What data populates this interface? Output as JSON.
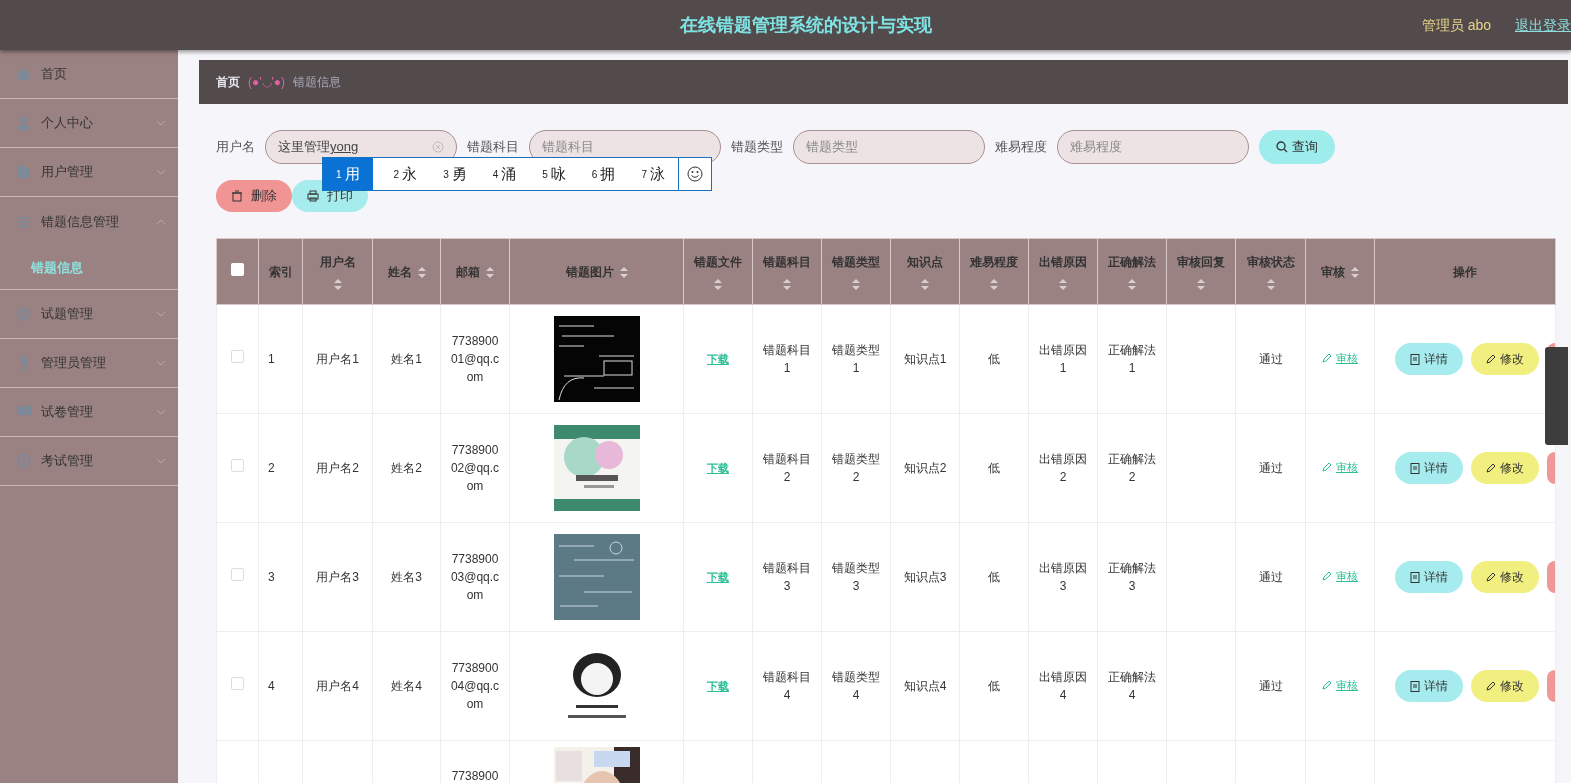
{
  "header": {
    "title": "在线错题管理系统的设计与实现",
    "user": "管理员 abo",
    "logout": "退出登录"
  },
  "sidebar": {
    "items": [
      {
        "label": "首页"
      },
      {
        "label": "个人中心",
        "expanded": false
      },
      {
        "label": "用户管理",
        "expanded": false
      },
      {
        "label": "错题信息管理",
        "expanded": true,
        "children": [
          {
            "label": "错题信息",
            "selected": true
          }
        ]
      },
      {
        "label": "试题管理",
        "expanded": false
      },
      {
        "label": "管理员管理",
        "expanded": false
      },
      {
        "label": "试卷管理",
        "expanded": false
      },
      {
        "label": "考试管理",
        "expanded": false
      }
    ]
  },
  "breadcrumb": {
    "home": "首页",
    "face": "(●'◡'●)",
    "current": "错题信息"
  },
  "search": {
    "fields": [
      {
        "label": "用户名",
        "value": "这里管理",
        "composing": "yong"
      },
      {
        "label": "错题科目",
        "placeholder": "错题科目"
      },
      {
        "label": "错题类型",
        "placeholder": "错题类型"
      },
      {
        "label": "难易程度",
        "placeholder": "难易程度"
      }
    ],
    "button": "查询"
  },
  "ime_candidates": {
    "items": [
      {
        "number": "1",
        "text": "用",
        "selected": true
      },
      {
        "number": "2",
        "text": "永",
        "selected": false
      },
      {
        "number": "3",
        "text": "勇",
        "selected": false
      },
      {
        "number": "4",
        "text": "涌",
        "selected": false
      },
      {
        "number": "5",
        "text": "咏",
        "selected": false
      },
      {
        "number": "6",
        "text": "拥",
        "selected": false
      },
      {
        "number": "7",
        "text": "泳",
        "selected": false
      }
    ]
  },
  "actions": [
    "删除",
    "打印"
  ],
  "table": {
    "select_all": {
      "checked": false
    },
    "columns": [
      {
        "label": "索引",
        "kind": "plain"
      },
      {
        "label": "用户名",
        "kind": "sort_below"
      },
      {
        "label": "姓名",
        "kind": "sort_inline"
      },
      {
        "label": "邮箱",
        "kind": "sort_inline"
      },
      {
        "label": "错题图片",
        "kind": "sort_inline"
      },
      {
        "label": "错题文件",
        "kind": "sort_below"
      },
      {
        "label": "错题科目",
        "kind": "sort_below"
      },
      {
        "label": "错题类型",
        "kind": "sort_below"
      },
      {
        "label": "知识点",
        "kind": "sort_below"
      },
      {
        "label": "难易程度",
        "kind": "sort_below"
      },
      {
        "label": "出错原因",
        "kind": "sort_below"
      },
      {
        "label": "正确解法",
        "kind": "sort_below"
      },
      {
        "label": "审核回复",
        "kind": "sort_below"
      },
      {
        "label": "审核状态",
        "kind": "sort_below"
      },
      {
        "label": "审核",
        "kind": "sort_inline"
      },
      {
        "label": "操作",
        "kind": "plain"
      }
    ],
    "rows": [
      {
        "checked": false,
        "index": "1",
        "username": "用户名1",
        "name": "姓名1",
        "email": "773890001@qq.com",
        "file": "下载",
        "subject": "错题科目1",
        "type": "错题类型1",
        "point": "知识点1",
        "difficulty": "低",
        "reason": "出错原因1",
        "solution": "正确解法1",
        "status": "通过",
        "review": "审核",
        "detail": "详情",
        "edit": "修改"
      },
      {
        "checked": false,
        "index": "2",
        "username": "用户名2",
        "name": "姓名2",
        "email": "773890002@qq.com",
        "file": "下载",
        "subject": "错题科目2",
        "type": "错题类型2",
        "point": "知识点2",
        "difficulty": "低",
        "reason": "出错原因2",
        "solution": "正确解法2",
        "status": "通过",
        "review": "审核",
        "detail": "详情",
        "edit": "修改"
      },
      {
        "checked": false,
        "index": "3",
        "username": "用户名3",
        "name": "姓名3",
        "email": "773890003@qq.com",
        "file": "下载",
        "subject": "错题科目3",
        "type": "错题类型3",
        "point": "知识点3",
        "difficulty": "低",
        "reason": "出错原因3",
        "solution": "正确解法3",
        "status": "通过",
        "review": "审核",
        "detail": "详情",
        "edit": "修改"
      },
      {
        "checked": false,
        "index": "4",
        "username": "用户名4",
        "name": "姓名4",
        "email": "773890004@qq.com",
        "file": "下载",
        "subject": "错题科目4",
        "type": "错题类型4",
        "point": "知识点4",
        "difficulty": "低",
        "reason": "出错原因4",
        "solution": "正确解法4",
        "status": "通过",
        "review": "审核",
        "detail": "详情",
        "edit": "修改"
      },
      {
        "email": "7738900"
      }
    ]
  }
}
